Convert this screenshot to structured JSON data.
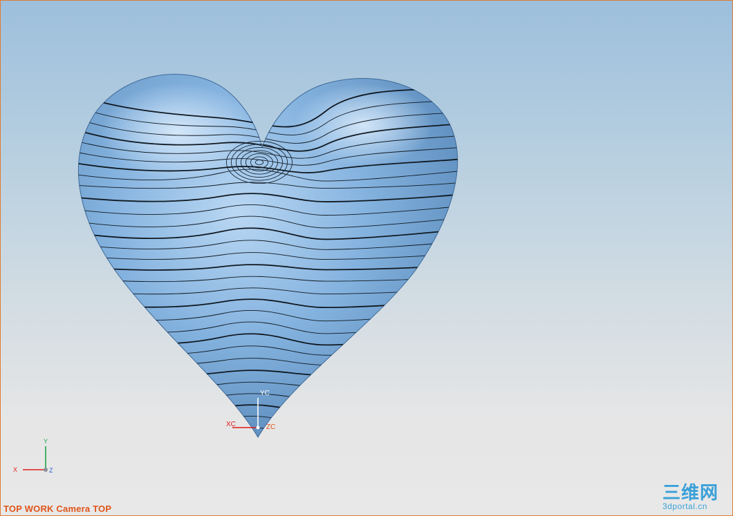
{
  "viewport": {
    "view_label": "TOP WORK Camera TOP",
    "border_color": "#e07a2e",
    "background_top": "#9dbfdc",
    "background_bottom": "#e8e8e8"
  },
  "model": {
    "shape": "heart",
    "surface_color": "#7fb0df",
    "contour_color": "#101820"
  },
  "work_csys": {
    "x_label": "XC",
    "y_label": "YC",
    "z_label": "ZC"
  },
  "view_triad": {
    "x_label": "X",
    "y_label": "Y",
    "z_label": "Z"
  },
  "watermark": {
    "brand_cn": "三维网",
    "brand_en": "3dportal.cn",
    "color": "#3aa0d8"
  }
}
